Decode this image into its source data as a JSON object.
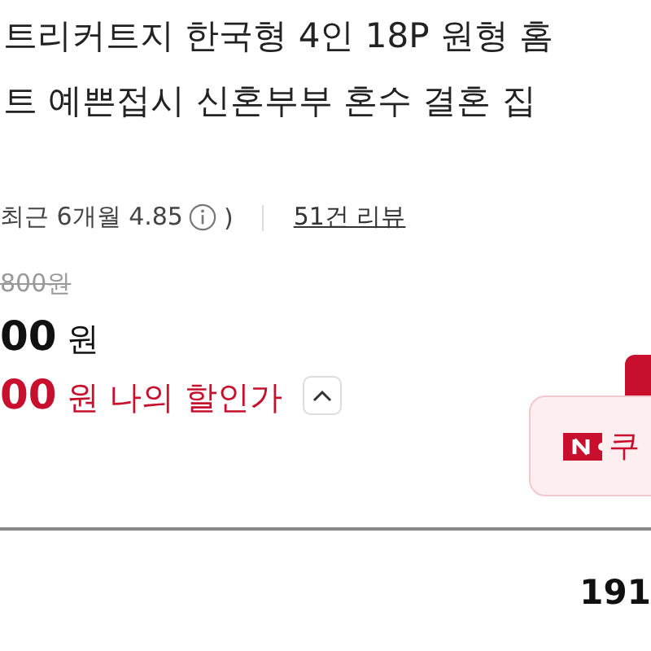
{
  "title_lines": [
    "트리커트지 한국형 4인 18P 원형 홈",
    "트 예쁜접시 신혼부부 혼수 결혼 집"
  ],
  "rating": {
    "text": "최근 6개월 4.85",
    "close": ")",
    "reviews": "51건 리뷰"
  },
  "price": {
    "original": "800원",
    "amount": "00",
    "unit": "원",
    "my_amount": "00",
    "my_unit": "원",
    "my_label": "나의 할인가",
    "expanded": true
  },
  "coupon": {
    "label": "쿠"
  },
  "bottom_value": "191"
}
